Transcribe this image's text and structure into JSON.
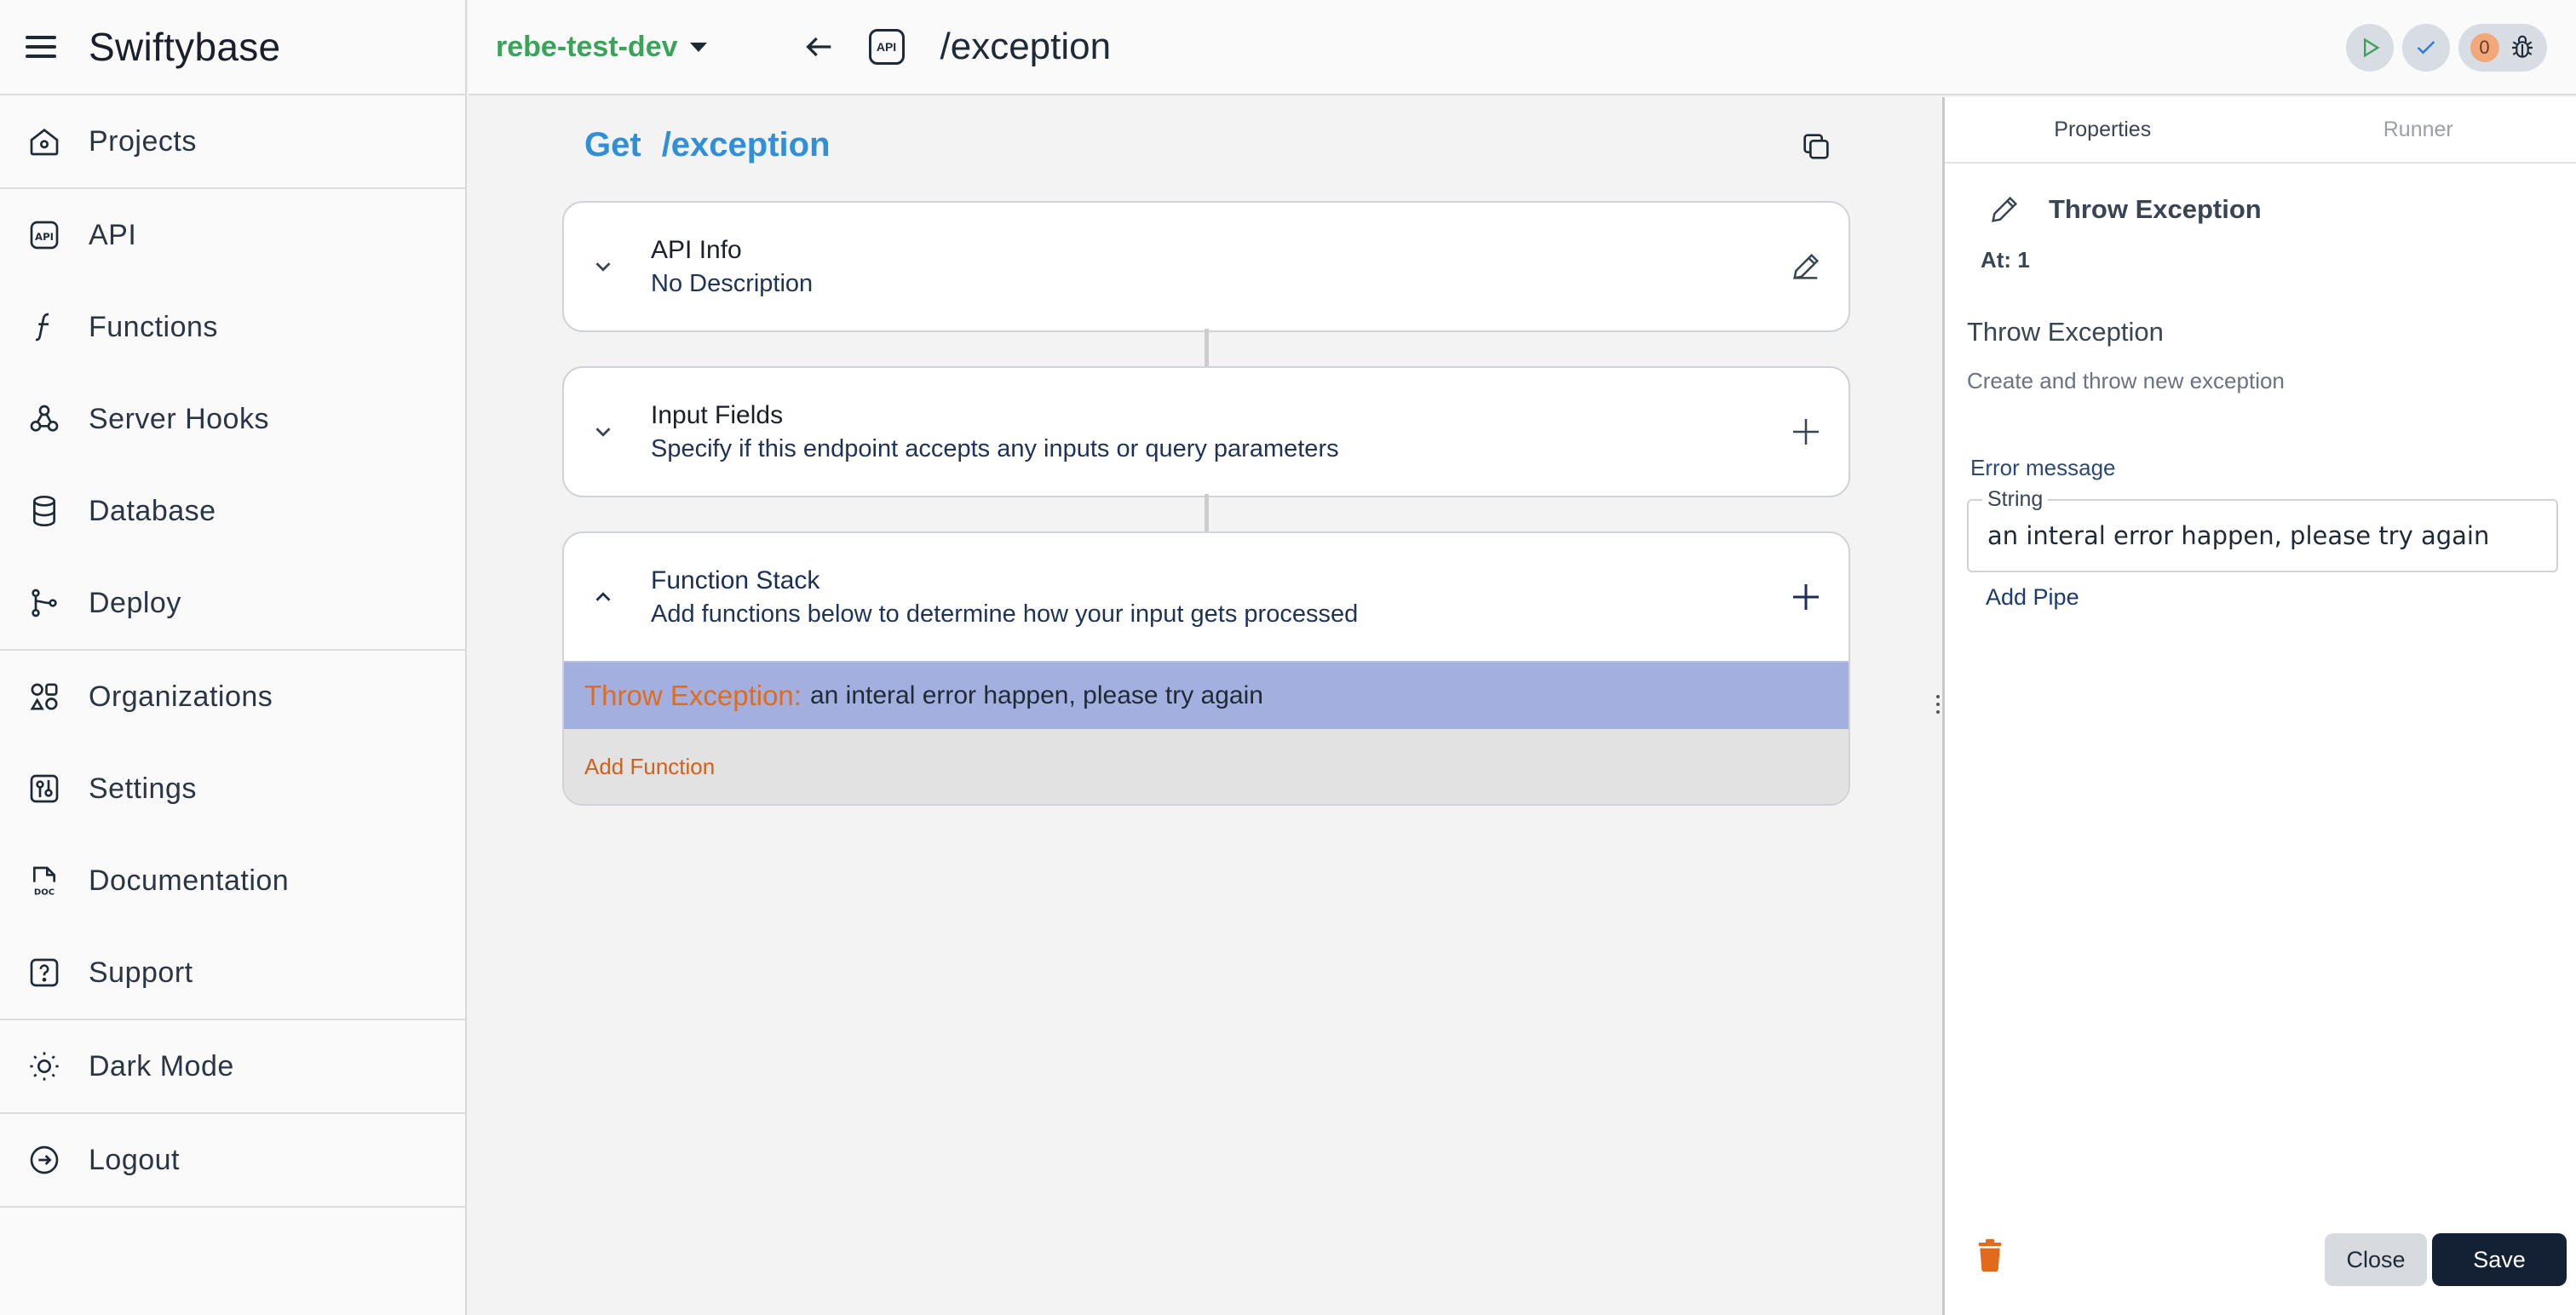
{
  "app": {
    "title": "Swiftybase"
  },
  "sidebar": {
    "groups": [
      [
        {
          "label": "Projects",
          "icon": "home-icon"
        }
      ],
      [
        {
          "label": "API",
          "icon": "api-icon"
        },
        {
          "label": "Functions",
          "icon": "function-icon"
        },
        {
          "label": "Server Hooks",
          "icon": "webhook-icon"
        },
        {
          "label": "Database",
          "icon": "database-icon"
        },
        {
          "label": "Deploy",
          "icon": "git-branch-icon"
        }
      ],
      [
        {
          "label": "Organizations",
          "icon": "organizations-icon"
        },
        {
          "label": "Settings",
          "icon": "settings-icon"
        },
        {
          "label": "Documentation",
          "icon": "document-icon"
        },
        {
          "label": "Support",
          "icon": "help-icon"
        }
      ],
      [
        {
          "label": "Dark Mode",
          "icon": "sun-icon"
        }
      ],
      [
        {
          "label": "Logout",
          "icon": "logout-icon"
        }
      ]
    ]
  },
  "topbar": {
    "project": "rebe-test-dev",
    "api_badge": "API",
    "path": "/exception",
    "debug_count": "0"
  },
  "canvas": {
    "method": "Get",
    "path": "/exception",
    "cards": {
      "api_info": {
        "title": "API Info",
        "subtitle": "No Description"
      },
      "input_fields": {
        "title": "Input Fields",
        "subtitle": "Specify if this endpoint accepts any inputs or query parameters"
      },
      "function_stack": {
        "title": "Function Stack",
        "subtitle": "Add functions below to determine how your input gets processed"
      }
    },
    "functions": [
      {
        "name": "Throw Exception:",
        "arg": "an interal error happen, please try again"
      }
    ],
    "add_function": "Add Function"
  },
  "panel": {
    "tabs": [
      "Properties",
      "Runner"
    ],
    "active_tab": "Properties",
    "header_title": "Throw Exception",
    "at": "At: 1",
    "name": "Throw Exception",
    "description": "Create and throw new exception",
    "field_label": "Error message",
    "field_type": "String",
    "field_value": "an interal error happen, please try again",
    "add_pipe": "Add Pipe",
    "close": "Close",
    "save": "Save"
  },
  "colors": {
    "project": "#3aa35a",
    "method": "#2f8fd8",
    "function_name": "#e26a1b",
    "function_row": "#a3b0df",
    "save_button": "#142033"
  }
}
